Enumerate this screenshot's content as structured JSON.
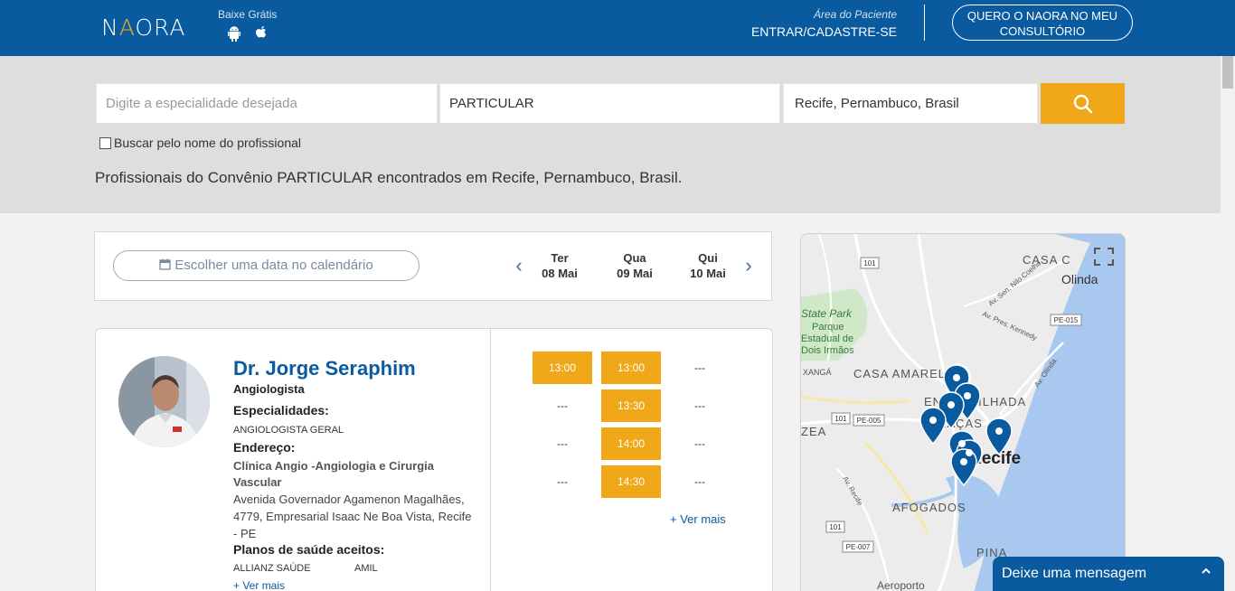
{
  "header": {
    "logo_text": "NAORA",
    "baixe_label": "Baixe Grátis",
    "area_label": "Área do Paciente",
    "entrar_label": "ENTRAR/CADASTRE-SE",
    "quero_label": "QUERO O NAORA NO MEU CONSULTÓRIO"
  },
  "search": {
    "specialty_placeholder": "Digite a especialidade desejada",
    "insurance_value": "PARTICULAR",
    "location_value": "Recife, Pernambuco, Brasil",
    "checkbox_label": "Buscar pelo nome do profissional",
    "result_text": "Profissionais do Convênio PARTICULAR encontrados em Recife, Pernambuco, Brasil."
  },
  "dates": {
    "calendar_label": "Escolher uma data no calendário",
    "days": [
      {
        "dow": "Ter",
        "date": "08 Mai"
      },
      {
        "dow": "Qua",
        "date": "09 Mai"
      },
      {
        "dow": "Qui",
        "date": "10 Mai"
      }
    ]
  },
  "doctor": {
    "name": "Dr. Jorge Seraphim",
    "specialty": "Angiologista",
    "especialidades_label": "Especialidades:",
    "especialidade": "ANGIOLOGISTA GERAL",
    "endereco_label": "Endereço:",
    "clinic": "Clínica Angio -Angiologia e Cirurgia Vascular",
    "address": "Avenida Governador Agamenon Magalhães, 4779, Empresarial Isaac Ne Boa Vista, Recife - PE",
    "planos_label": "Planos de saúde aceitos:",
    "planos": [
      "ALLIANZ SAÚDE",
      "AMIL"
    ],
    "ver_mais": "+ Ver mais"
  },
  "slots": {
    "col1": [
      "13:00",
      "---",
      "---",
      "---"
    ],
    "col2": [
      "13:00",
      "13:30",
      "14:00",
      "14:30"
    ],
    "col3": [
      "---",
      "---",
      "---",
      "---"
    ],
    "ver_mais": "+ Ver mais"
  },
  "map": {
    "labels": [
      "CASA AMARELA",
      "ENCRUZILHADA",
      "GRAÇAS",
      "ZEA",
      "Recife",
      "AFOGADOS",
      "PINA",
      "Aeroporto",
      "Olinda",
      "CASA C",
      "State Park",
      "Parque",
      "Estadual de",
      "Dois Irmãos",
      "XANGÁ",
      "Av. Sen. Nilo Coelho",
      "Av. Pres. Kennedy",
      "Av. Olinda",
      "Av. Recife"
    ],
    "shields": [
      "101",
      "101",
      "101",
      "PE-015",
      "PE-005",
      "PE-007"
    ]
  },
  "chat": {
    "label": "Deixe uma mensagem"
  },
  "colors": {
    "brand_blue": "#0a5aa0",
    "accent_orange": "#f0a818"
  }
}
